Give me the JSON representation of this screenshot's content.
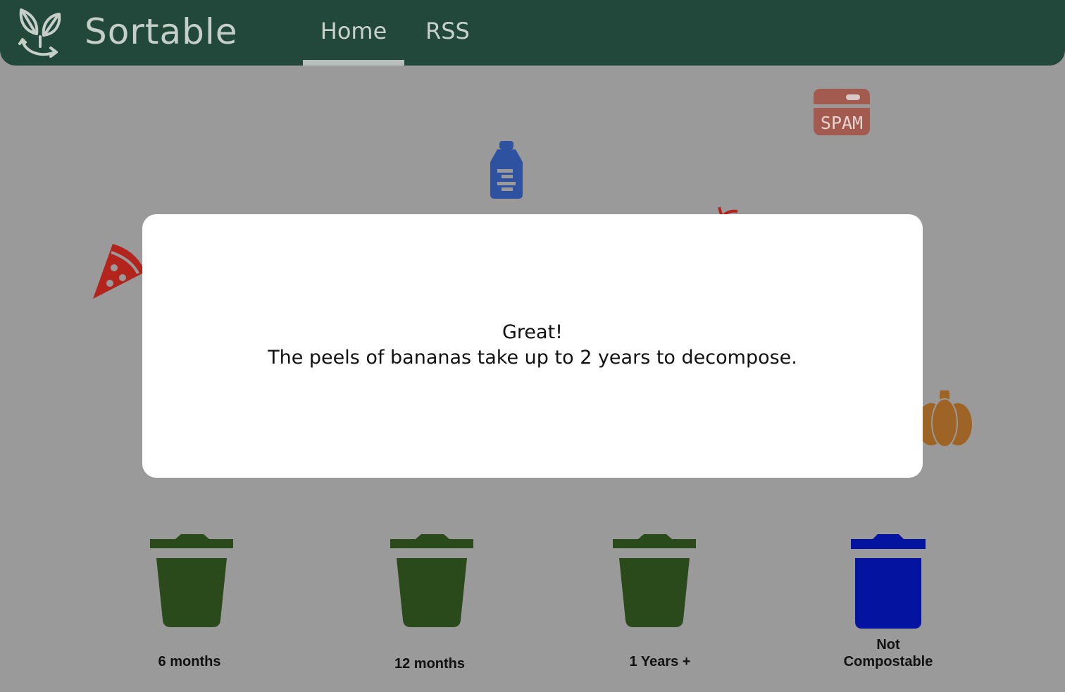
{
  "header": {
    "brand": "Sortable",
    "logo_icon": "leaf-recycle-icon",
    "nav": [
      {
        "label": "Home",
        "active": true
      },
      {
        "label": "RSS",
        "active": false
      }
    ],
    "colors": {
      "bar": "#22473b",
      "text": "#c5cfc9"
    }
  },
  "items": [
    {
      "name": "spam-can",
      "icon": "spam-can-icon",
      "label": "SPAM",
      "color": "#a35a4f"
    },
    {
      "name": "water-bottle",
      "icon": "bottle-icon",
      "color": "#2f52a0"
    },
    {
      "name": "pizza-slice",
      "icon": "pizza-icon",
      "color": "#b3241c"
    },
    {
      "name": "apple",
      "icon": "apple-icon",
      "color": "#b3241c"
    },
    {
      "name": "pumpkin",
      "icon": "pumpkin-icon",
      "color": "#9e6426"
    }
  ],
  "modal": {
    "line1": "Great!",
    "line2": "The peels of bananas take up to 2 years to decompose."
  },
  "bins": [
    {
      "label": "6  months",
      "color": "#2a4a1c",
      "icon": "trash-bin-icon"
    },
    {
      "label": "12 months",
      "color": "#2a4a1c",
      "icon": "trash-bin-icon"
    },
    {
      "label": "1 Years +",
      "color": "#2a4a1c",
      "icon": "trash-bin-icon"
    },
    {
      "label_line1": "Not",
      "label_line2": "Compostable",
      "color": "#0414a0",
      "icon": "trash-bin-icon"
    }
  ]
}
